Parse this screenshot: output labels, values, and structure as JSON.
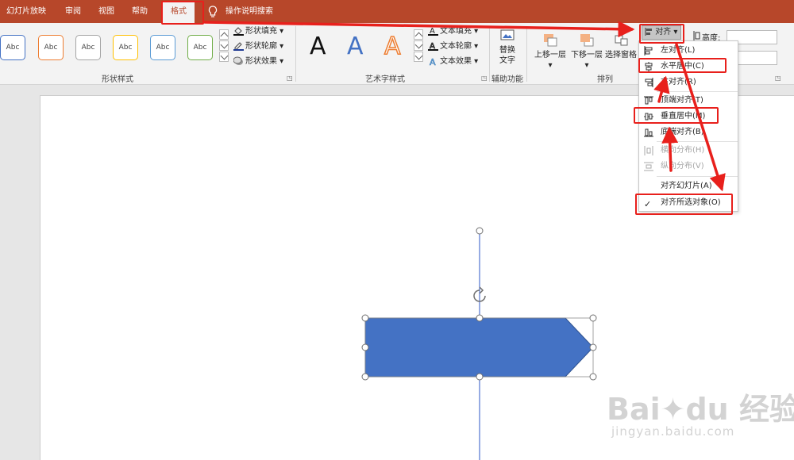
{
  "tabs": [
    {
      "label": "幻灯片放映"
    },
    {
      "label": "审阅"
    },
    {
      "label": "视图"
    },
    {
      "label": "帮助"
    },
    {
      "label": "格式"
    }
  ],
  "search": {
    "label": "操作说明搜索"
  },
  "ribbon": {
    "shape_styles": {
      "group_label": "形状样式",
      "swatch_text": "Abc",
      "swatch_colors": [
        "#4472c4",
        "#ed7d31",
        "#a5a5a5",
        "#ffc000",
        "#5b9bd5",
        "#70ad47"
      ],
      "fill": "形状填充",
      "outline": "形状轮廓",
      "effects": "形状效果"
    },
    "wordart": {
      "group_label": "艺术字样式",
      "glyph": "A",
      "text_fill": "文本填充",
      "text_outline": "文本轮廓",
      "text_effects": "文本效果"
    },
    "accessibility": {
      "group_label": "辅助功能",
      "alt_text_line1": "替换",
      "alt_text_line2": "文字"
    },
    "arrange": {
      "group_label": "排列",
      "bring_forward": "上移一层",
      "send_backward": "下移一层",
      "selection_pane": "选择窗格",
      "align": "对齐",
      "height_label": "高度:"
    }
  },
  "align_menu": {
    "items": [
      {
        "label": "左对齐(L)",
        "disabled": false
      },
      {
        "label": "水平居中(C)",
        "disabled": false
      },
      {
        "label": "右对齐(R)",
        "disabled": false
      },
      {
        "label": "顶端对齐(T)",
        "disabled": false
      },
      {
        "label": "垂直居中(M)",
        "disabled": false
      },
      {
        "label": "底端对齐(B)",
        "disabled": false
      },
      {
        "label": "横向分布(H)",
        "disabled": true
      },
      {
        "label": "纵向分布(V)",
        "disabled": true
      },
      {
        "label": "对齐幻灯片(A)",
        "disabled": false
      },
      {
        "label": "对齐所选对象(O)",
        "disabled": false
      }
    ],
    "check_glyph": "✓"
  },
  "colors": {
    "accent": "#b7472a",
    "shape_fill": "#4472c4",
    "annotation_red": "#e8201c"
  },
  "watermark": {
    "line1": "Bai",
    "logo": "du",
    "brand": "经验",
    "url": "jingyan.baidu.com"
  }
}
